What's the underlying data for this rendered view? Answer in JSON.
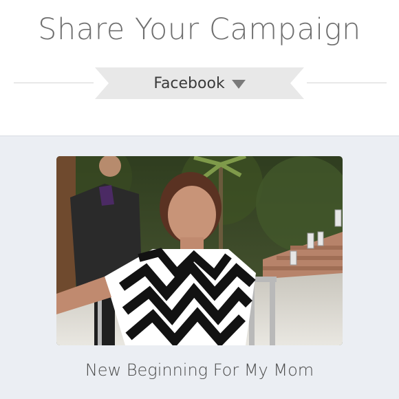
{
  "header": {
    "title": "Share Your Campaign",
    "share_selector": {
      "selected": "Facebook",
      "icon": "caret-down-icon"
    }
  },
  "campaign": {
    "photo_description": "campaign-photo",
    "name": "New Beginning For My Mom"
  },
  "colors": {
    "header_bg": "#ffffff",
    "body_bg": "#ebeef3",
    "banner_bg": "#e8e8e8",
    "title_text": "#6f6f6f"
  }
}
